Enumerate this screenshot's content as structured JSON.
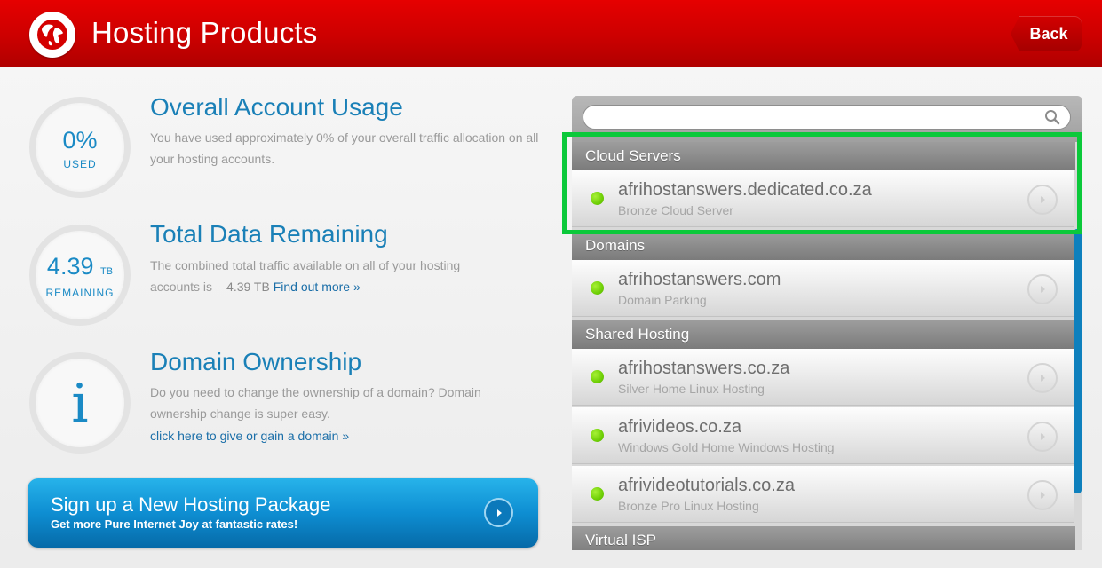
{
  "header": {
    "title": "Hosting Products",
    "back_label": "Back",
    "logo_icon": "globe-icon",
    "accent": "#e00000"
  },
  "usage": {
    "value": "0%",
    "sub": "USED",
    "title": "Overall Account Usage",
    "text": "You have used approximately 0% of your overall traffic allocation on all your hosting accounts."
  },
  "remaining": {
    "value": "4.39",
    "unit": "TB",
    "sub": "REMAINING",
    "title": "Total Data Remaining",
    "text": "The combined total traffic available on all of your hosting accounts is",
    "amount": "4.39 TB",
    "link": "Find out more »"
  },
  "ownership": {
    "icon": "info-icon",
    "glyph": "i",
    "title": "Domain Ownership",
    "text": "Do you need to change the ownership of a domain? Domain ownership change is super easy.",
    "link": "click here to give or gain a domain »"
  },
  "signup": {
    "title": "Sign up a New Hosting Package",
    "sub": "Get more Pure Internet Joy at fantastic rates!"
  },
  "search": {
    "placeholder": ""
  },
  "groups": [
    {
      "label": "Cloud Servers",
      "items": [
        {
          "name": "afrihostanswers.dedicated.co.za",
          "desc": "Bronze Cloud Server",
          "status": "active"
        }
      ]
    },
    {
      "label": "Domains",
      "items": [
        {
          "name": "afrihostanswers.com",
          "desc": "Domain Parking",
          "status": "active"
        }
      ]
    },
    {
      "label": "Shared Hosting",
      "items": [
        {
          "name": "afrihostanswers.co.za",
          "desc": "Silver Home Linux Hosting",
          "status": "active"
        },
        {
          "name": "afrivideos.co.za",
          "desc": "Windows Gold Home Windows Hosting",
          "status": "active"
        },
        {
          "name": "afrivideotutorials.co.za",
          "desc": "Bronze Pro Linux Hosting",
          "status": "active"
        }
      ]
    },
    {
      "label": "Virtual ISP",
      "items": []
    }
  ],
  "colors": {
    "status_active": "#6fcf06",
    "highlight": "#0bc93a",
    "link": "#1a80b7"
  }
}
